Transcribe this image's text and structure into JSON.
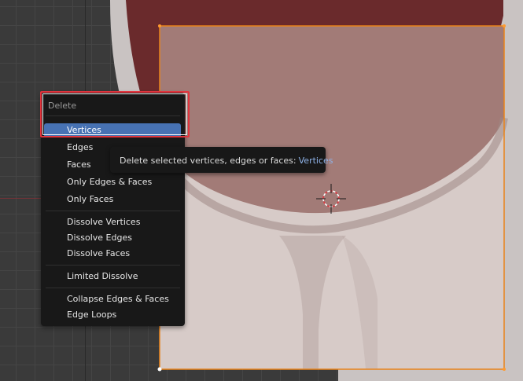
{
  "colors": {
    "viewport_bg": "#3a3a3a",
    "grid": "#454545",
    "axis_red": "#8a3036",
    "face_upper": "#a27b77",
    "face_lower": "#d7cbc8",
    "face_outline": "#e9831a",
    "menu_bg": "#181818",
    "menu_active": "#4772b3",
    "highlight": "#e2343d",
    "tooltip_value": "#8fb3e8"
  },
  "menu": {
    "title": "Delete",
    "items": [
      {
        "label": "Vertices",
        "active": true
      },
      {
        "label": "Edges",
        "active": false
      },
      {
        "label": "Faces",
        "active": false
      },
      {
        "label": "Only Edges & Faces",
        "active": false
      },
      {
        "label": "Only Faces",
        "active": false
      },
      {
        "label": "Dissolve Vertices",
        "active": false
      },
      {
        "label": "Dissolve Edges",
        "active": false
      },
      {
        "label": "Dissolve Faces",
        "active": false
      },
      {
        "label": "Limited Dissolve",
        "active": false
      },
      {
        "label": "Collapse Edges & Faces",
        "active": false
      },
      {
        "label": "Edge Loops",
        "active": false
      }
    ]
  },
  "tooltip": {
    "text": "Delete selected vertices, edges or faces:",
    "value": "Vertices"
  },
  "icons": {
    "cursor": "3d-cursor-icon"
  }
}
